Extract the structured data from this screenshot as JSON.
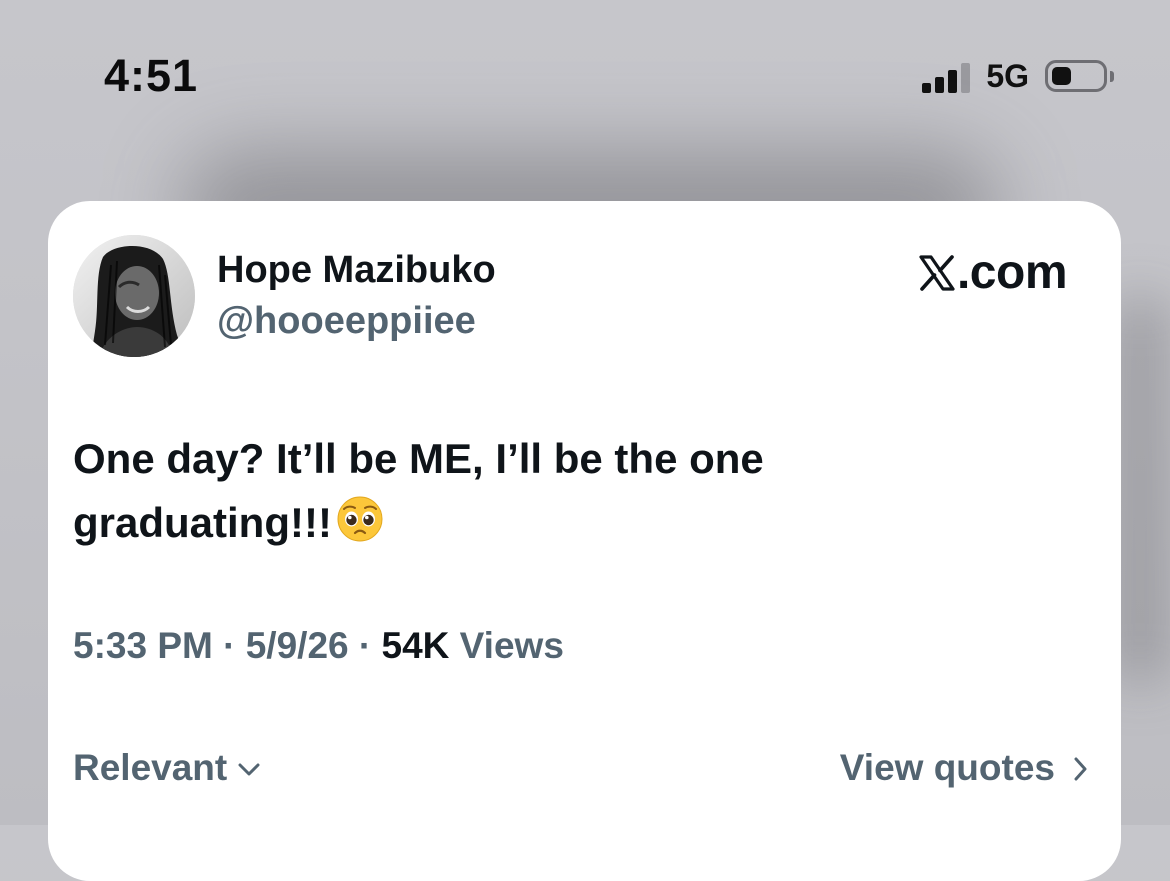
{
  "status_bar": {
    "time": "4:51",
    "network": "5G",
    "signal_bars": 3,
    "signal_max": 4
  },
  "tweet": {
    "display_name": "Hope Mazibuko",
    "handle": "@hooeeppiiee",
    "brand_label": ".com",
    "brand_icon": "x-logo-icon",
    "text": "One day? It’ll be ME, I’ll be the one graduating!!!",
    "emoji_icon": "pleading-face-emoji",
    "time": "5:33 PM",
    "separator": " · ",
    "date": "5/9/26",
    "views_count": "54K",
    "views_label": "Views"
  },
  "actions": {
    "sort_label": "Relevant",
    "quotes_label": "View quotes"
  },
  "colors": {
    "background": "#c4c4c9",
    "card": "#ffffff",
    "text_primary": "#0f1419",
    "text_secondary": "#536471"
  }
}
